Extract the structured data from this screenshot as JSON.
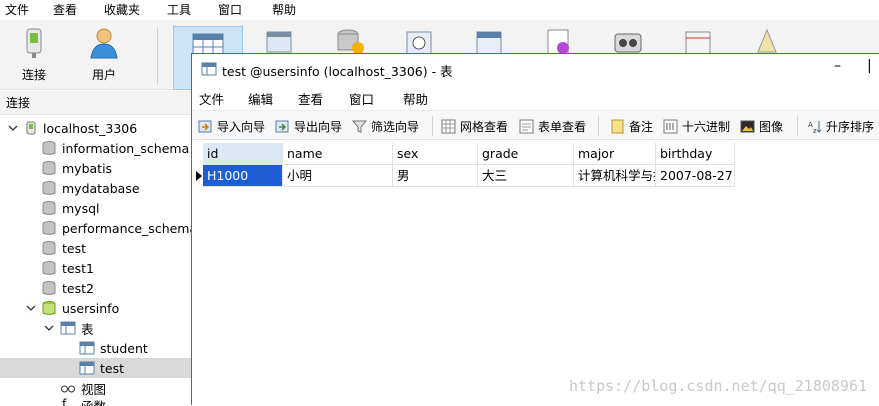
{
  "menubar": {
    "items": [
      "文件",
      "查看",
      "收藏夹",
      "工具",
      "窗口",
      "帮助"
    ]
  },
  "toolbar": {
    "connect_label": "连接",
    "user_label": "用户"
  },
  "nav": {
    "header": "连接",
    "root": "localhost_3306",
    "databases": [
      "information_schema",
      "mybatis",
      "mydatabase",
      "mysql",
      "performance_schema",
      "test",
      "test1",
      "test2"
    ],
    "usersinfo": "usersinfo",
    "tables_label": "表",
    "tables": [
      "student",
      "test"
    ],
    "views_label": "视图",
    "partial_label": "函数"
  },
  "child": {
    "title": "test @usersinfo (localhost_3306) - 表",
    "minimize": "–",
    "menu": [
      "文件",
      "编辑",
      "查看",
      "窗口",
      "帮助"
    ],
    "tools": {
      "import": "导入向导",
      "export": "导出向导",
      "filter": "筛选向导",
      "grid_view": "网格查看",
      "form_view": "表单查看",
      "memo": "备注",
      "hex": "十六进制",
      "image": "图像",
      "sort": "升序排序"
    }
  },
  "grid": {
    "columns": [
      "id",
      "name",
      "sex",
      "grade",
      "major",
      "birthday"
    ],
    "rows": [
      [
        "H1000",
        "小明",
        "男",
        "大三",
        "计算机科学与技",
        "2007-08-27"
      ]
    ]
  },
  "watermark": "https://blog.csdn.net/qq_21808961",
  "colors": {
    "selection": "#1e5ed4",
    "active_tool": "#cce4f7",
    "header_highlight": "#dbe9f5"
  }
}
